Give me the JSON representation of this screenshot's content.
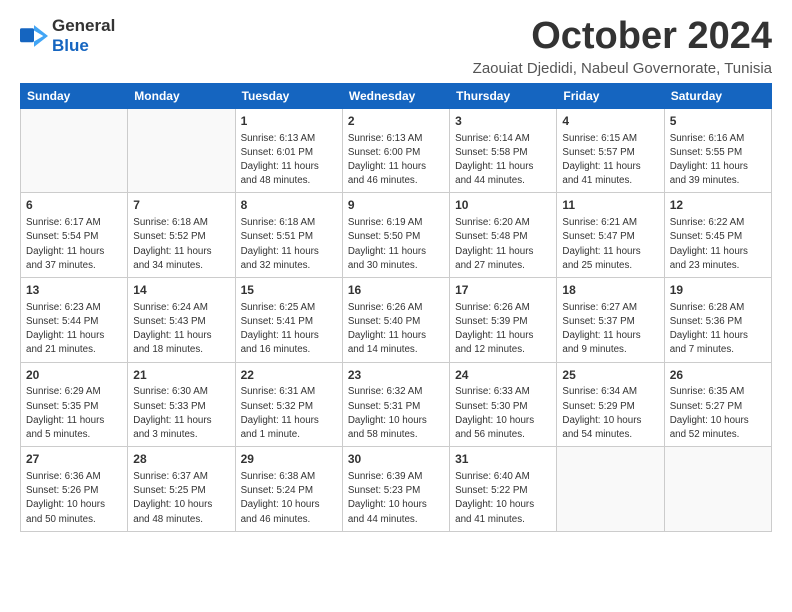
{
  "header": {
    "logo": {
      "general": "General",
      "blue": "Blue"
    },
    "title": "October 2024",
    "subtitle": "Zaouiat Djedidi, Nabeul Governorate, Tunisia"
  },
  "weekdays": [
    "Sunday",
    "Monday",
    "Tuesday",
    "Wednesday",
    "Thursday",
    "Friday",
    "Saturday"
  ],
  "weeks": [
    [
      {
        "day": "",
        "info": ""
      },
      {
        "day": "",
        "info": ""
      },
      {
        "day": "1",
        "info": "Sunrise: 6:13 AM\nSunset: 6:01 PM\nDaylight: 11 hours and 48 minutes."
      },
      {
        "day": "2",
        "info": "Sunrise: 6:13 AM\nSunset: 6:00 PM\nDaylight: 11 hours and 46 minutes."
      },
      {
        "day": "3",
        "info": "Sunrise: 6:14 AM\nSunset: 5:58 PM\nDaylight: 11 hours and 44 minutes."
      },
      {
        "day": "4",
        "info": "Sunrise: 6:15 AM\nSunset: 5:57 PM\nDaylight: 11 hours and 41 minutes."
      },
      {
        "day": "5",
        "info": "Sunrise: 6:16 AM\nSunset: 5:55 PM\nDaylight: 11 hours and 39 minutes."
      }
    ],
    [
      {
        "day": "6",
        "info": "Sunrise: 6:17 AM\nSunset: 5:54 PM\nDaylight: 11 hours and 37 minutes."
      },
      {
        "day": "7",
        "info": "Sunrise: 6:18 AM\nSunset: 5:52 PM\nDaylight: 11 hours and 34 minutes."
      },
      {
        "day": "8",
        "info": "Sunrise: 6:18 AM\nSunset: 5:51 PM\nDaylight: 11 hours and 32 minutes."
      },
      {
        "day": "9",
        "info": "Sunrise: 6:19 AM\nSunset: 5:50 PM\nDaylight: 11 hours and 30 minutes."
      },
      {
        "day": "10",
        "info": "Sunrise: 6:20 AM\nSunset: 5:48 PM\nDaylight: 11 hours and 27 minutes."
      },
      {
        "day": "11",
        "info": "Sunrise: 6:21 AM\nSunset: 5:47 PM\nDaylight: 11 hours and 25 minutes."
      },
      {
        "day": "12",
        "info": "Sunrise: 6:22 AM\nSunset: 5:45 PM\nDaylight: 11 hours and 23 minutes."
      }
    ],
    [
      {
        "day": "13",
        "info": "Sunrise: 6:23 AM\nSunset: 5:44 PM\nDaylight: 11 hours and 21 minutes."
      },
      {
        "day": "14",
        "info": "Sunrise: 6:24 AM\nSunset: 5:43 PM\nDaylight: 11 hours and 18 minutes."
      },
      {
        "day": "15",
        "info": "Sunrise: 6:25 AM\nSunset: 5:41 PM\nDaylight: 11 hours and 16 minutes."
      },
      {
        "day": "16",
        "info": "Sunrise: 6:26 AM\nSunset: 5:40 PM\nDaylight: 11 hours and 14 minutes."
      },
      {
        "day": "17",
        "info": "Sunrise: 6:26 AM\nSunset: 5:39 PM\nDaylight: 11 hours and 12 minutes."
      },
      {
        "day": "18",
        "info": "Sunrise: 6:27 AM\nSunset: 5:37 PM\nDaylight: 11 hours and 9 minutes."
      },
      {
        "day": "19",
        "info": "Sunrise: 6:28 AM\nSunset: 5:36 PM\nDaylight: 11 hours and 7 minutes."
      }
    ],
    [
      {
        "day": "20",
        "info": "Sunrise: 6:29 AM\nSunset: 5:35 PM\nDaylight: 11 hours and 5 minutes."
      },
      {
        "day": "21",
        "info": "Sunrise: 6:30 AM\nSunset: 5:33 PM\nDaylight: 11 hours and 3 minutes."
      },
      {
        "day": "22",
        "info": "Sunrise: 6:31 AM\nSunset: 5:32 PM\nDaylight: 11 hours and 1 minute."
      },
      {
        "day": "23",
        "info": "Sunrise: 6:32 AM\nSunset: 5:31 PM\nDaylight: 10 hours and 58 minutes."
      },
      {
        "day": "24",
        "info": "Sunrise: 6:33 AM\nSunset: 5:30 PM\nDaylight: 10 hours and 56 minutes."
      },
      {
        "day": "25",
        "info": "Sunrise: 6:34 AM\nSunset: 5:29 PM\nDaylight: 10 hours and 54 minutes."
      },
      {
        "day": "26",
        "info": "Sunrise: 6:35 AM\nSunset: 5:27 PM\nDaylight: 10 hours and 52 minutes."
      }
    ],
    [
      {
        "day": "27",
        "info": "Sunrise: 6:36 AM\nSunset: 5:26 PM\nDaylight: 10 hours and 50 minutes."
      },
      {
        "day": "28",
        "info": "Sunrise: 6:37 AM\nSunset: 5:25 PM\nDaylight: 10 hours and 48 minutes."
      },
      {
        "day": "29",
        "info": "Sunrise: 6:38 AM\nSunset: 5:24 PM\nDaylight: 10 hours and 46 minutes."
      },
      {
        "day": "30",
        "info": "Sunrise: 6:39 AM\nSunset: 5:23 PM\nDaylight: 10 hours and 44 minutes."
      },
      {
        "day": "31",
        "info": "Sunrise: 6:40 AM\nSunset: 5:22 PM\nDaylight: 10 hours and 41 minutes."
      },
      {
        "day": "",
        "info": ""
      },
      {
        "day": "",
        "info": ""
      }
    ]
  ]
}
